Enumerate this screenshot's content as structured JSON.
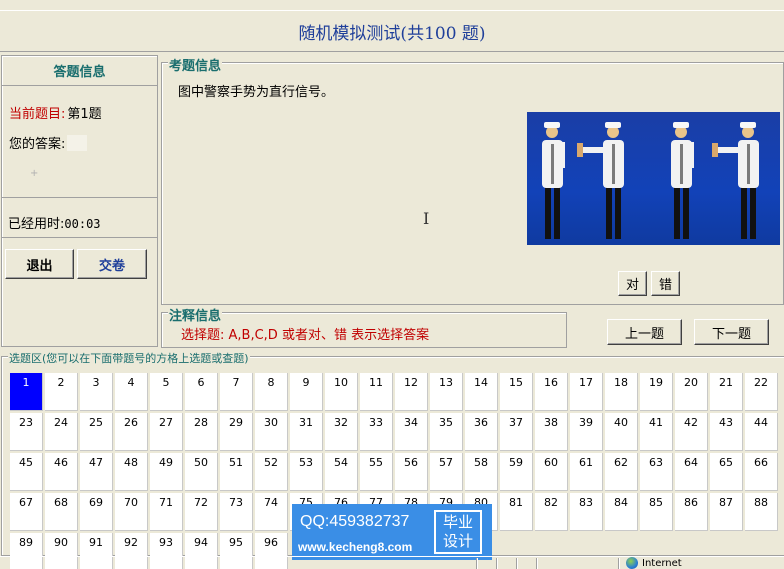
{
  "header": {
    "title": "随机模拟测试(共100 题)"
  },
  "left_panel": {
    "title": "答题信息",
    "current_label": "当前题目:",
    "current_value": "第1题",
    "answer_label": "您的答案:",
    "answer_value": "",
    "elapsed_label": "已经用时:",
    "elapsed_value": "00:03",
    "exit_label": "退出",
    "submit_label": "交卷"
  },
  "question_panel": {
    "title": "考题信息",
    "text": "图中警察手势为直行信号。",
    "right_label": "对",
    "wrong_label": "错"
  },
  "note_panel": {
    "title": "注释信息",
    "text": "选择题: A,B,C,D 或者对、错 表示选择答案"
  },
  "nav": {
    "prev_label": "上一题",
    "next_label": "下一题"
  },
  "select_area": {
    "title": "选题区(您可以在下面带题号的方格上选题或查题)",
    "selected": 1,
    "numbers": [
      "1",
      "2",
      "3",
      "4",
      "5",
      "6",
      "7",
      "8",
      "9",
      "10",
      "11",
      "12",
      "13",
      "14",
      "15",
      "16",
      "17",
      "18",
      "19",
      "20",
      "21",
      "22",
      "23",
      "24",
      "25",
      "26",
      "27",
      "28",
      "29",
      "30",
      "31",
      "32",
      "33",
      "34",
      "35",
      "36",
      "37",
      "38",
      "39",
      "40",
      "41",
      "42",
      "43",
      "44",
      "45",
      "46",
      "47",
      "48",
      "49",
      "50",
      "51",
      "52",
      "53",
      "54",
      "55",
      "56",
      "57",
      "58",
      "59",
      "60",
      "61",
      "62",
      "63",
      "64",
      "65",
      "66",
      "67",
      "68",
      "69",
      "70",
      "71",
      "72",
      "73",
      "74",
      "75",
      "76",
      "77",
      "78",
      "79",
      "80",
      "81",
      "82",
      "83",
      "84",
      "85",
      "86",
      "87",
      "88",
      "89",
      "90",
      "91",
      "92",
      "93",
      "94",
      "95",
      "96"
    ]
  },
  "status_bar": {
    "zone": "Internet"
  },
  "watermark": {
    "qq": "QQ:459382737",
    "url": "www.kecheng8.com",
    "badge_line1": "毕业",
    "badge_line2": "设计"
  },
  "colors": {
    "selected_cell": "#0000ff",
    "accent_red": "#c00000",
    "title_blue": "#1f3f9a",
    "photo_bg": "#1242b8"
  }
}
